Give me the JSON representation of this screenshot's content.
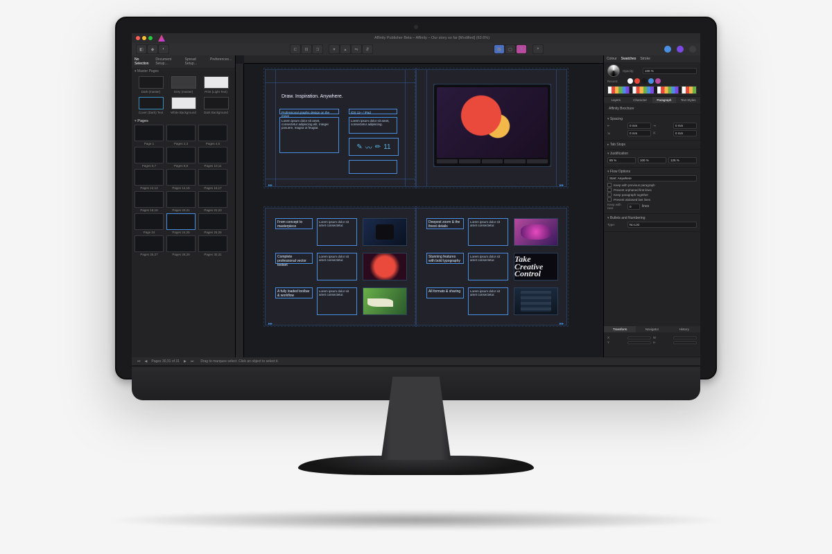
{
  "window": {
    "title": "Affinity Publisher Beta – Affinity – Our story so far [Modified] (63.6%)"
  },
  "toolbar": {
    "persona_designer": "Designer",
    "persona_photo": "Photo",
    "selection_status": "No Selection"
  },
  "left": {
    "tabs": [
      "No Selection",
      "Document Setup…",
      "Spread Setup…",
      "Preferences…"
    ],
    "master_label": "Master Pages",
    "swatches_row1": [
      "Dark (master)",
      "Grey (master)",
      "Print (Light Text)"
    ],
    "swatches_row2": [
      "Cover (Dark) Text",
      "White Background",
      "Dark Background"
    ],
    "pages_header": "Pages",
    "pages": [
      {
        "label": "Page 1",
        "cls": "gradD"
      },
      {
        "label": "Pages 2,3",
        "cls": "gradA"
      },
      {
        "label": "Pages 4,5",
        "cls": "gradA"
      },
      {
        "label": "Pages 6,7",
        "cls": "gradC"
      },
      {
        "label": "Pages 8,9",
        "cls": "gradB"
      },
      {
        "label": "Pages 10,11",
        "cls": "gradA"
      },
      {
        "label": "Pages 12,13",
        "cls": "gradE"
      },
      {
        "label": "Pages 14,15",
        "cls": "gradB"
      },
      {
        "label": "Pages 16,17",
        "cls": "gradC"
      },
      {
        "label": "Pages 18,19",
        "cls": "gradD"
      },
      {
        "label": "Pages 20,21",
        "cls": "gradA"
      },
      {
        "label": "Pages 22,23",
        "cls": "gradE"
      },
      {
        "label": "Page 24",
        "cls": "gradD"
      },
      {
        "label": "Pages 24,25",
        "cls": "gradB",
        "sel": true
      },
      {
        "label": "Pages 25,26",
        "cls": "gradC"
      },
      {
        "label": "Pages 25,27",
        "cls": "gradA"
      },
      {
        "label": "Pages 28,29",
        "cls": "gradE"
      },
      {
        "label": "Pages 30,31",
        "cls": "gradB"
      }
    ]
  },
  "canvas": {
    "spread1": {
      "headline": "Draw. Inspiration. Anywhere.",
      "sub_left": "Professional graphic design on the move",
      "body_left": "Lorem ipsum dolor sit amet, consectetur adipiscing elit. Integer posuere, magna ut feugiat.",
      "sub_right": "iOS 11+ / iPad",
      "body_right": "Lorem ipsum dolor sit amet, consectetur adipiscing.",
      "icon_number": "11"
    },
    "spread2": {
      "cells": [
        {
          "h": "From concept to masterpiece",
          "b": "Lorem ipsum dolor sit amet consectetur."
        },
        {
          "h": "Complete professional vector toolset",
          "b": "Lorem ipsum dolor sit amet consectetur."
        },
        {
          "h": "A fully loaded toolbar & workflow",
          "b": "Lorem ipsum dolor sit amet consectetur."
        },
        {
          "h": "Deepest zoom & the finest details",
          "b": "Lorem ipsum dolor sit amet consectetur."
        },
        {
          "h": "Stunning features with bold typography",
          "b": "Lorem ipsum dolor sit amet consectetur."
        },
        {
          "h": "All formats & sharing",
          "b": "Lorem ipsum dolor sit amet consectetur."
        }
      ]
    }
  },
  "right": {
    "tabs_top": [
      "Colour",
      "Swatches",
      "Stroke"
    ],
    "opacity_label": "Opacity:",
    "opacity_value": "100 %",
    "recent_label": "Recent:",
    "tabs_mid": [
      "Layers",
      "Character",
      "Paragraph",
      "Text Styles"
    ],
    "style_group": "Affinity Brochure",
    "spacing_header": "Spacing",
    "left_indent": "0 mm",
    "right_indent": "0 mm",
    "first_line": "0 mm",
    "last_line": "0 mm",
    "tab_stops_header": "Tab Stops",
    "justification_header": "Justification",
    "j_min": "85 %",
    "j_des": "100 %",
    "j_max": "125 %",
    "flow_header": "Flow Options",
    "flow_mode": "Start: Anywhere",
    "flow_checks": [
      "Keep with previous paragraph",
      "Prevent orphaned first lines",
      "Keep paragraph together",
      "Prevent widowed last lines"
    ],
    "keep_with_next_label": "Keep with next",
    "keep_with_next_val": "0",
    "lines_label": "lines",
    "bullets_header": "Bullets and Numbering",
    "list_type_label": "Type:",
    "list_type": "No List",
    "nav_tabs": [
      "Transform",
      "Navigator",
      "History"
    ]
  },
  "statusbar": {
    "page_display": "Pages 30,31 of 31",
    "hint": "Drag to marquee select. Click an object to select it."
  },
  "colors": {
    "accent": "#4a90e2",
    "affinity_orange": "#e94e3c",
    "affinity_purple": "#b93aff"
  }
}
